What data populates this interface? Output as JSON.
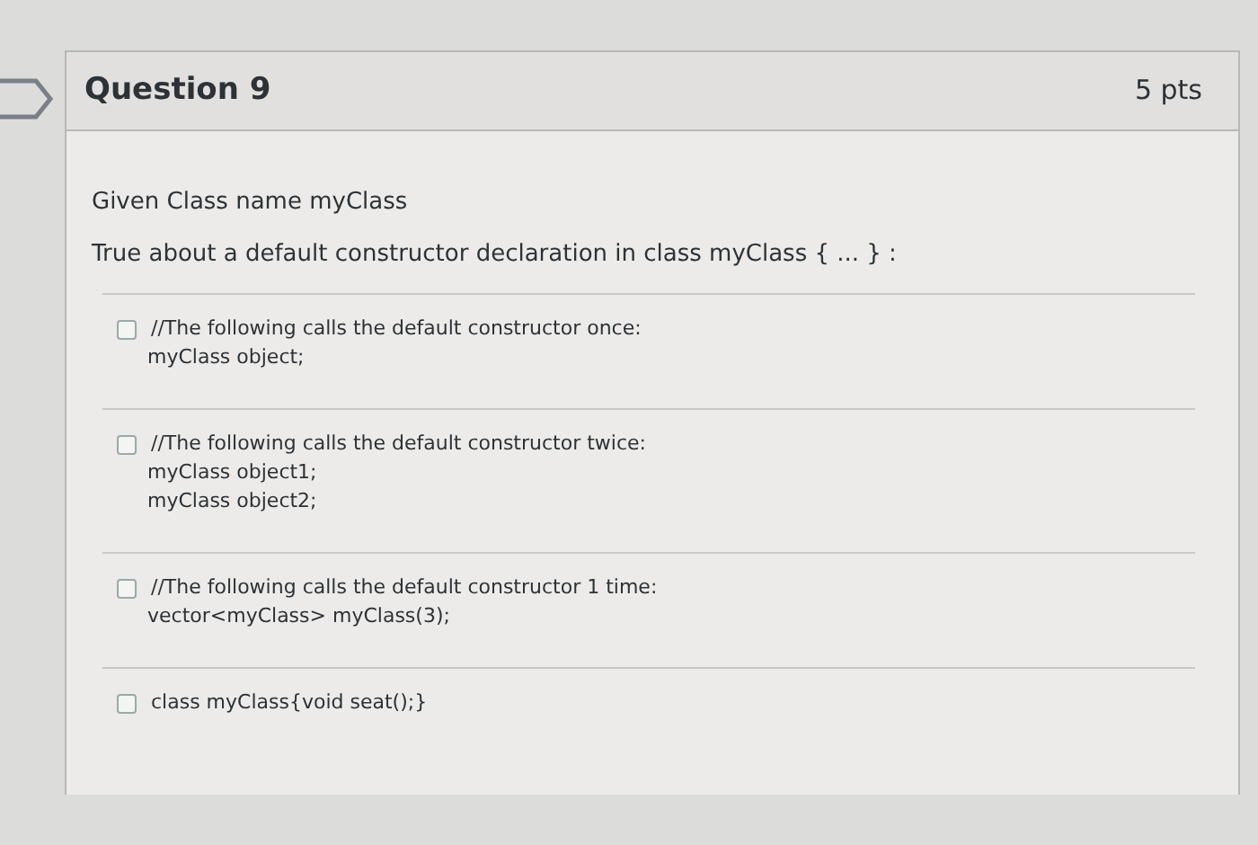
{
  "question": {
    "title": "Question 9",
    "points": "5 pts"
  },
  "prompt": [
    "Given Class name myClass",
    "True about a default constructor declaration in class myClass { ... } :"
  ],
  "options": [
    {
      "checked": false,
      "lines": [
        "//The following calls the default constructor once:",
        "myClass object;"
      ]
    },
    {
      "checked": false,
      "lines": [
        "//The following calls the default constructor twice:",
        "myClass object1;",
        "myClass object2;"
      ]
    },
    {
      "checked": false,
      "lines": [
        "//The following calls the default constructor 1 time:",
        "vector<myClass> myClass(3);"
      ]
    },
    {
      "checked": false,
      "lines": [
        "class myClass{void seat();}"
      ]
    }
  ]
}
